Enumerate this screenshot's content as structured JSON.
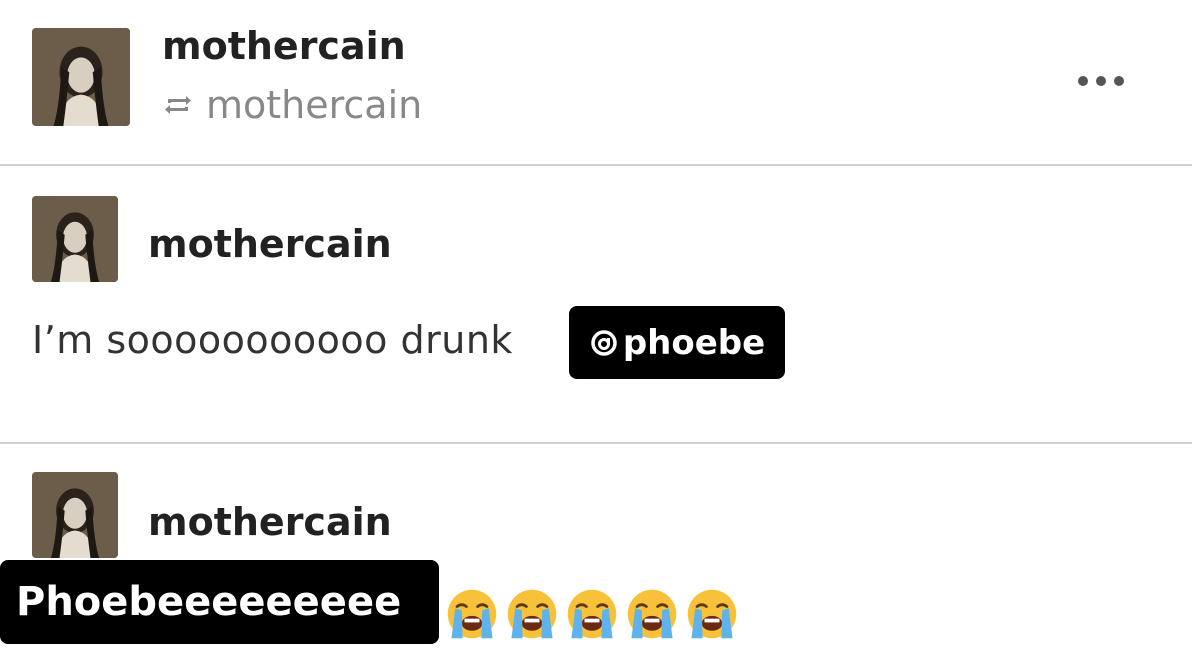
{
  "post": {
    "author": "mothercain",
    "reblog_source": "mothercain",
    "reblog_icon": "reblog-icon",
    "more_icon": "more-options-icon"
  },
  "comments": [
    {
      "author": "mothercain",
      "text": "I’m sooooooooooo drunk",
      "tag": "phoebe",
      "tag_icon": "threads-icon"
    },
    {
      "author": "mothercain",
      "emoji_icon": "loudly-crying-face-icon",
      "emoji_count": 5
    }
  ],
  "overlay": {
    "name_tag": "Phoebeeeeeeeee"
  },
  "colors": {
    "tag_background": "#000000",
    "tag_text": "#ffffff",
    "divider": "#d0d0d0",
    "secondary_text": "#888888"
  }
}
